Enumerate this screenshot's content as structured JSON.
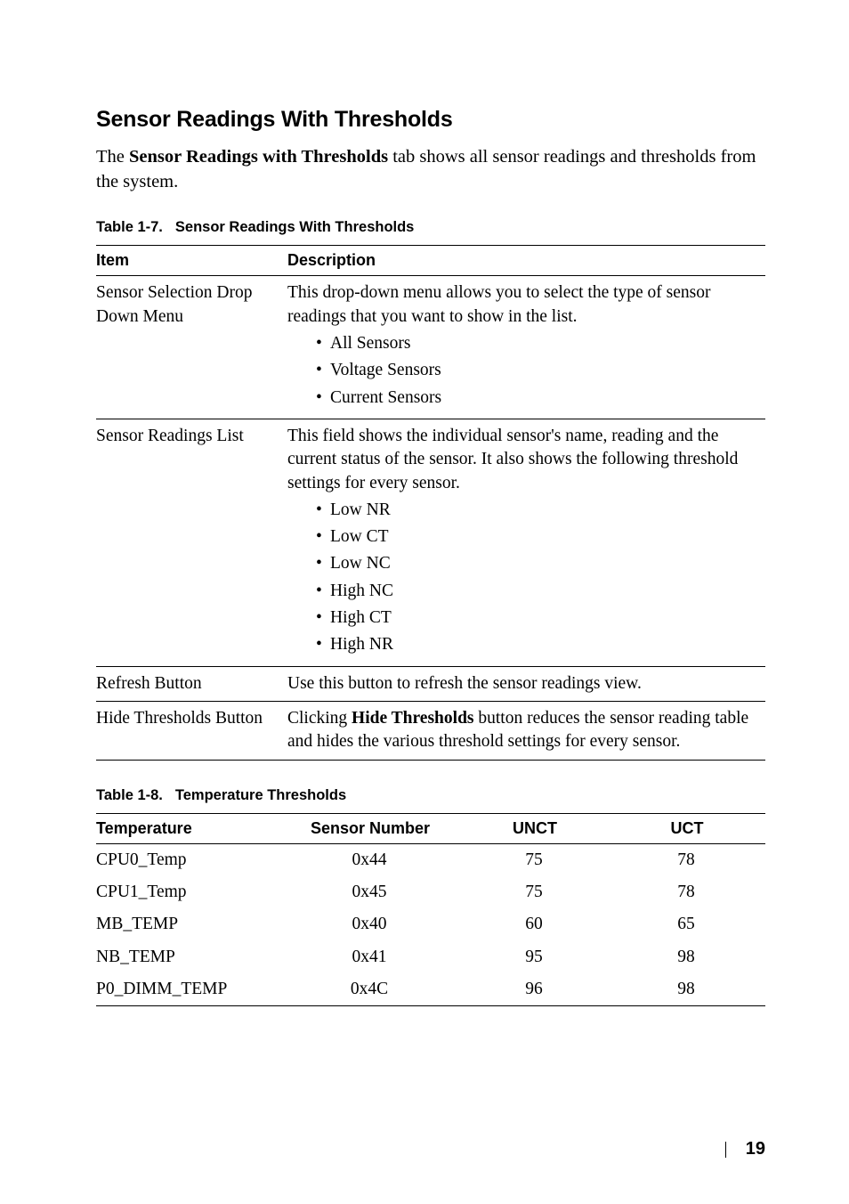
{
  "section": {
    "heading": "Sensor Readings With Thresholds",
    "intro_pre": "The ",
    "intro_bold": "Sensor Readings with Thresholds",
    "intro_post": " tab shows all sensor readings and thresholds from the system."
  },
  "table1": {
    "caption_num": "Table 1-7.",
    "caption_title": "Sensor Readings With Thresholds",
    "headers": {
      "item": "Item",
      "desc": "Description"
    },
    "rows": [
      {
        "item": "Sensor Selection Drop Down Menu",
        "desc": "This drop-down menu allows you to select the type of sensor readings that you want to show in the list.",
        "bullets": [
          "All Sensors",
          "Voltage Sensors",
          "Current Sensors"
        ]
      },
      {
        "item": "Sensor Readings List",
        "desc": "This field shows the individual sensor's name, reading and the current status of the sensor. It also shows the following threshold settings for every sensor.",
        "bullets": [
          "Low NR",
          "Low CT",
          "Low NC",
          "High NC",
          "High CT",
          "High NR"
        ]
      },
      {
        "item": "Refresh Button",
        "desc": "Use this button to refresh the sensor readings view."
      },
      {
        "item": "Hide Thresholds Button",
        "desc_pre": "Clicking ",
        "desc_bold": "Hide Thresholds",
        "desc_post": " button reduces the sensor reading table and hides the various threshold settings for every sensor."
      }
    ]
  },
  "table2": {
    "caption_num": "Table 1-8.",
    "caption_title": "Temperature Thresholds",
    "headers": {
      "temp": "Temperature",
      "sensor": "Sensor Number",
      "unct": "UNCT",
      "uct": "UCT"
    },
    "rows": [
      {
        "temp": "CPU0_Temp",
        "sensor": "0x44",
        "unct": "75",
        "uct": "78"
      },
      {
        "temp": "CPU1_Temp",
        "sensor": "0x45",
        "unct": "75",
        "uct": "78"
      },
      {
        "temp": "MB_TEMP",
        "sensor": "0x40",
        "unct": "60",
        "uct": "65"
      },
      {
        "temp": "NB_TEMP",
        "sensor": "0x41",
        "unct": "95",
        "uct": "98"
      },
      {
        "temp": "P0_DIMM_TEMP",
        "sensor": "0x4C",
        "unct": "96",
        "uct": "98"
      }
    ]
  },
  "chart_data": {
    "type": "table",
    "title": "Temperature Thresholds",
    "columns": [
      "Temperature",
      "Sensor Number",
      "UNCT",
      "UCT"
    ],
    "rows": [
      [
        "CPU0_Temp",
        "0x44",
        75,
        78
      ],
      [
        "CPU1_Temp",
        "0x45",
        75,
        78
      ],
      [
        "MB_TEMP",
        "0x40",
        60,
        65
      ],
      [
        "NB_TEMP",
        "0x41",
        95,
        98
      ],
      [
        "P0_DIMM_TEMP",
        "0x4C",
        96,
        98
      ]
    ]
  },
  "footer": {
    "page": "19"
  }
}
